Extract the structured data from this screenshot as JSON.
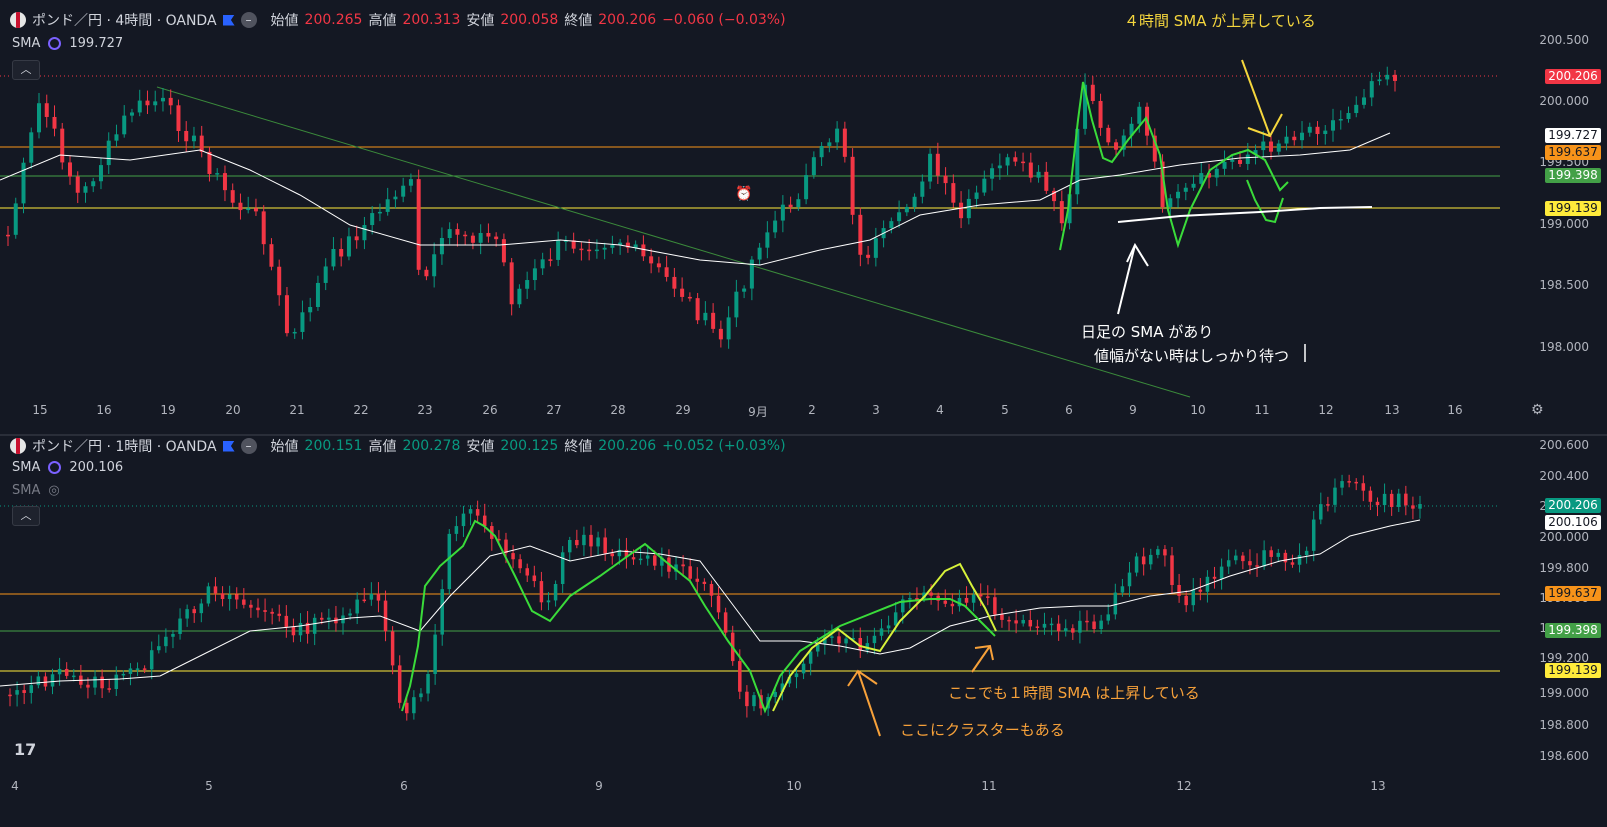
{
  "top": {
    "symbol": "ポンド／円 · 4時間 · OANDA",
    "o_label": "始値",
    "o": "200.265",
    "h_label": "高値",
    "h": "200.313",
    "l_label": "安値",
    "l": "200.058",
    "c_label": "終値",
    "c": "200.206",
    "chg": "−0.060 (−0.03%)",
    "sma_label": "SMA",
    "sma_value": "199.727",
    "y_ticks": [
      "200.500",
      "200.000",
      "199.500",
      "199.000",
      "198.500",
      "198.000"
    ],
    "x_ticks": [
      "15",
      "16",
      "19",
      "20",
      "21",
      "22",
      "23",
      "26",
      "27",
      "28",
      "29",
      "9月",
      "2",
      "3",
      "4",
      "5",
      "6",
      "9",
      "10",
      "11",
      "12",
      "13",
      "16"
    ],
    "price_tags": {
      "last": "200.206",
      "sma": "199.727",
      "orange": "199.637",
      "green": "199.398",
      "yellow": "199.139"
    },
    "annotations": {
      "title": "４時間 SMA が上昇している",
      "note1": "日足の SMA があり",
      "note2": "値幅がない時はしっかり待つ"
    }
  },
  "bottom": {
    "symbol": "ポンド／円 · 1時間 · OANDA",
    "o_label": "始値",
    "o": "200.151",
    "h_label": "高値",
    "h": "200.278",
    "l_label": "安値",
    "l": "200.125",
    "c_label": "終値",
    "c": "200.206",
    "chg": "+0.052 (+0.03%)",
    "sma_label": "SMA",
    "sma_value": "200.106",
    "sma2_label": "SMA",
    "y_ticks": [
      "200.600",
      "200.400",
      "200.200",
      "200.000",
      "199.800",
      "199.600",
      "199.400",
      "199.200",
      "199.000",
      "198.800",
      "198.600"
    ],
    "x_ticks": [
      "4",
      "5",
      "6",
      "9",
      "10",
      "11",
      "12",
      "13"
    ],
    "price_tags": {
      "last": "200.206",
      "sma": "200.106",
      "orange": "199.637",
      "green": "199.398",
      "yellow": "199.139"
    },
    "annotations": {
      "note1": "ここでも１時間 SMA は上昇している",
      "note2": "ここにクラスターもある"
    }
  },
  "colors": {
    "bg": "#141823",
    "up": "#089981",
    "down": "#f23645",
    "orange": "#f7931a",
    "green": "#4caf50",
    "yellow": "#ffeb3b",
    "anno_yellow": "#f5d63d",
    "anno_orange": "#f7a13a"
  },
  "icons": [
    "tradingview-logo-icon",
    "settings-icon",
    "alert-clock-icon",
    "chevron-up-icon",
    "eye-off-icon",
    "symbol-flag-icon"
  ]
}
